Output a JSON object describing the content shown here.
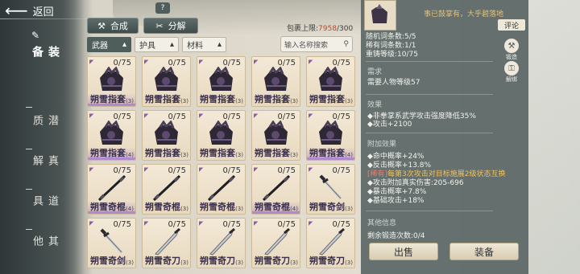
{
  "nav": {
    "back_label": "返回",
    "help_label": "?",
    "tabs": [
      {
        "label": "装备",
        "active": true
      },
      {
        "label": "潜质",
        "active": false
      },
      {
        "label": "真解",
        "active": false
      },
      {
        "label": "道具",
        "active": false
      },
      {
        "label": "其他",
        "active": false
      }
    ]
  },
  "toolbar": {
    "synthesize_label": "合成",
    "decompose_label": "分解",
    "capacity_label": "包裹上限:",
    "capacity_used": "7958",
    "capacity_sep": "/",
    "capacity_max": "300"
  },
  "filters": {
    "weapon": "武器",
    "armor": "护具",
    "material": "材料",
    "search_placeholder": "输入名称搜索"
  },
  "items": [
    {
      "name": "朔雪指套",
      "dur": "0/75",
      "level": "(3)",
      "icon": "glove-icon",
      "purple": true
    },
    {
      "name": "朔雪指套",
      "dur": "0/75",
      "level": "(3)",
      "icon": "glove-icon",
      "purple": false
    },
    {
      "name": "朔雪指套",
      "dur": "0/75",
      "level": "(3)",
      "icon": "glove-icon",
      "purple": false
    },
    {
      "name": "朔雪指套",
      "dur": "0/75",
      "level": "(3)",
      "icon": "glove-icon",
      "purple": false
    },
    {
      "name": "朔雪指套",
      "dur": "0/75",
      "level": "(3)",
      "icon": "glove-icon",
      "purple": false
    },
    {
      "name": "朔雪指套",
      "dur": "0/75",
      "level": "(4)",
      "icon": "glove-icon",
      "purple": true
    },
    {
      "name": "朔雪指套",
      "dur": "0/75",
      "level": "(3)",
      "icon": "glove-icon",
      "purple": false
    },
    {
      "name": "朔雪指套",
      "dur": "0/75",
      "level": "(3)",
      "icon": "glove-icon",
      "purple": false
    },
    {
      "name": "朔雪指套",
      "dur": "0/75",
      "level": "(3)",
      "icon": "glove-icon",
      "purple": false
    },
    {
      "name": "朔雪指套",
      "dur": "0/75",
      "level": "(4)",
      "icon": "glove-icon",
      "purple": true
    },
    {
      "name": "朔雪奇棍",
      "dur": "0/75",
      "level": "(4)",
      "icon": "staff-icon",
      "purple": true
    },
    {
      "name": "朔雪奇棍",
      "dur": "0/75",
      "level": "(3)",
      "icon": "staff-icon",
      "purple": false
    },
    {
      "name": "朔雪奇棍",
      "dur": "0/75",
      "level": "(3)",
      "icon": "staff-icon",
      "purple": false
    },
    {
      "name": "朔雪奇棍",
      "dur": "0/75",
      "level": "(4)",
      "icon": "staff-icon",
      "purple": true
    },
    {
      "name": "朔雪奇剑",
      "dur": "0/75",
      "level": "(3)",
      "icon": "sword-icon",
      "purple": false
    },
    {
      "name": "朔雪奇剑",
      "dur": "0/75",
      "level": "(3)",
      "icon": "sword-icon",
      "purple": false
    },
    {
      "name": "朔雪奇刀",
      "dur": "0/75",
      "level": "(3)",
      "icon": "blade-icon",
      "purple": false
    },
    {
      "name": "朔雪奇刀",
      "dur": "0/75",
      "level": "(3)",
      "icon": "blade-icon",
      "purple": false
    },
    {
      "name": "朔雪奇刀",
      "dur": "0/75",
      "level": "(3)",
      "icon": "blade-icon",
      "purple": false
    },
    {
      "name": "朔雪奇刀",
      "dur": "0/75",
      "level": "(3)",
      "icon": "blade-icon",
      "purple": false
    }
  ],
  "detail": {
    "title_partial": "事已鼓掌有，大乎碧落地",
    "comment_label": "评论",
    "random_entries": "随机词条数:5/5",
    "rare_entries": "稀有词条数:1/1",
    "reforge_level": "重铸等级:10/75",
    "forge_label": "锻造",
    "unbind_label": "解绑",
    "req_heading": "需求",
    "req_value": "需要人物等级57",
    "effect_heading": "效果",
    "effect_1": "非拳掌系武学攻击强度降低35%",
    "effect_2": "攻击+2100",
    "extra_heading": "附加效果",
    "extra_1": "命中概率+24%",
    "extra_2": "反击概率+13.8%",
    "extra_rare_tag": "[稀有]",
    "extra_rare_text": "每第3次攻击对目标施展2级状态互换",
    "extra_4": "攻击附加真实伤害:205-696",
    "extra_5": "暴击概率+7.8%",
    "extra_6": "基础攻击+18%",
    "other_heading": "其他信息",
    "other_value": "剩余锻造次数:0/4",
    "sell_label": "出售",
    "equip_label": "装备"
  }
}
